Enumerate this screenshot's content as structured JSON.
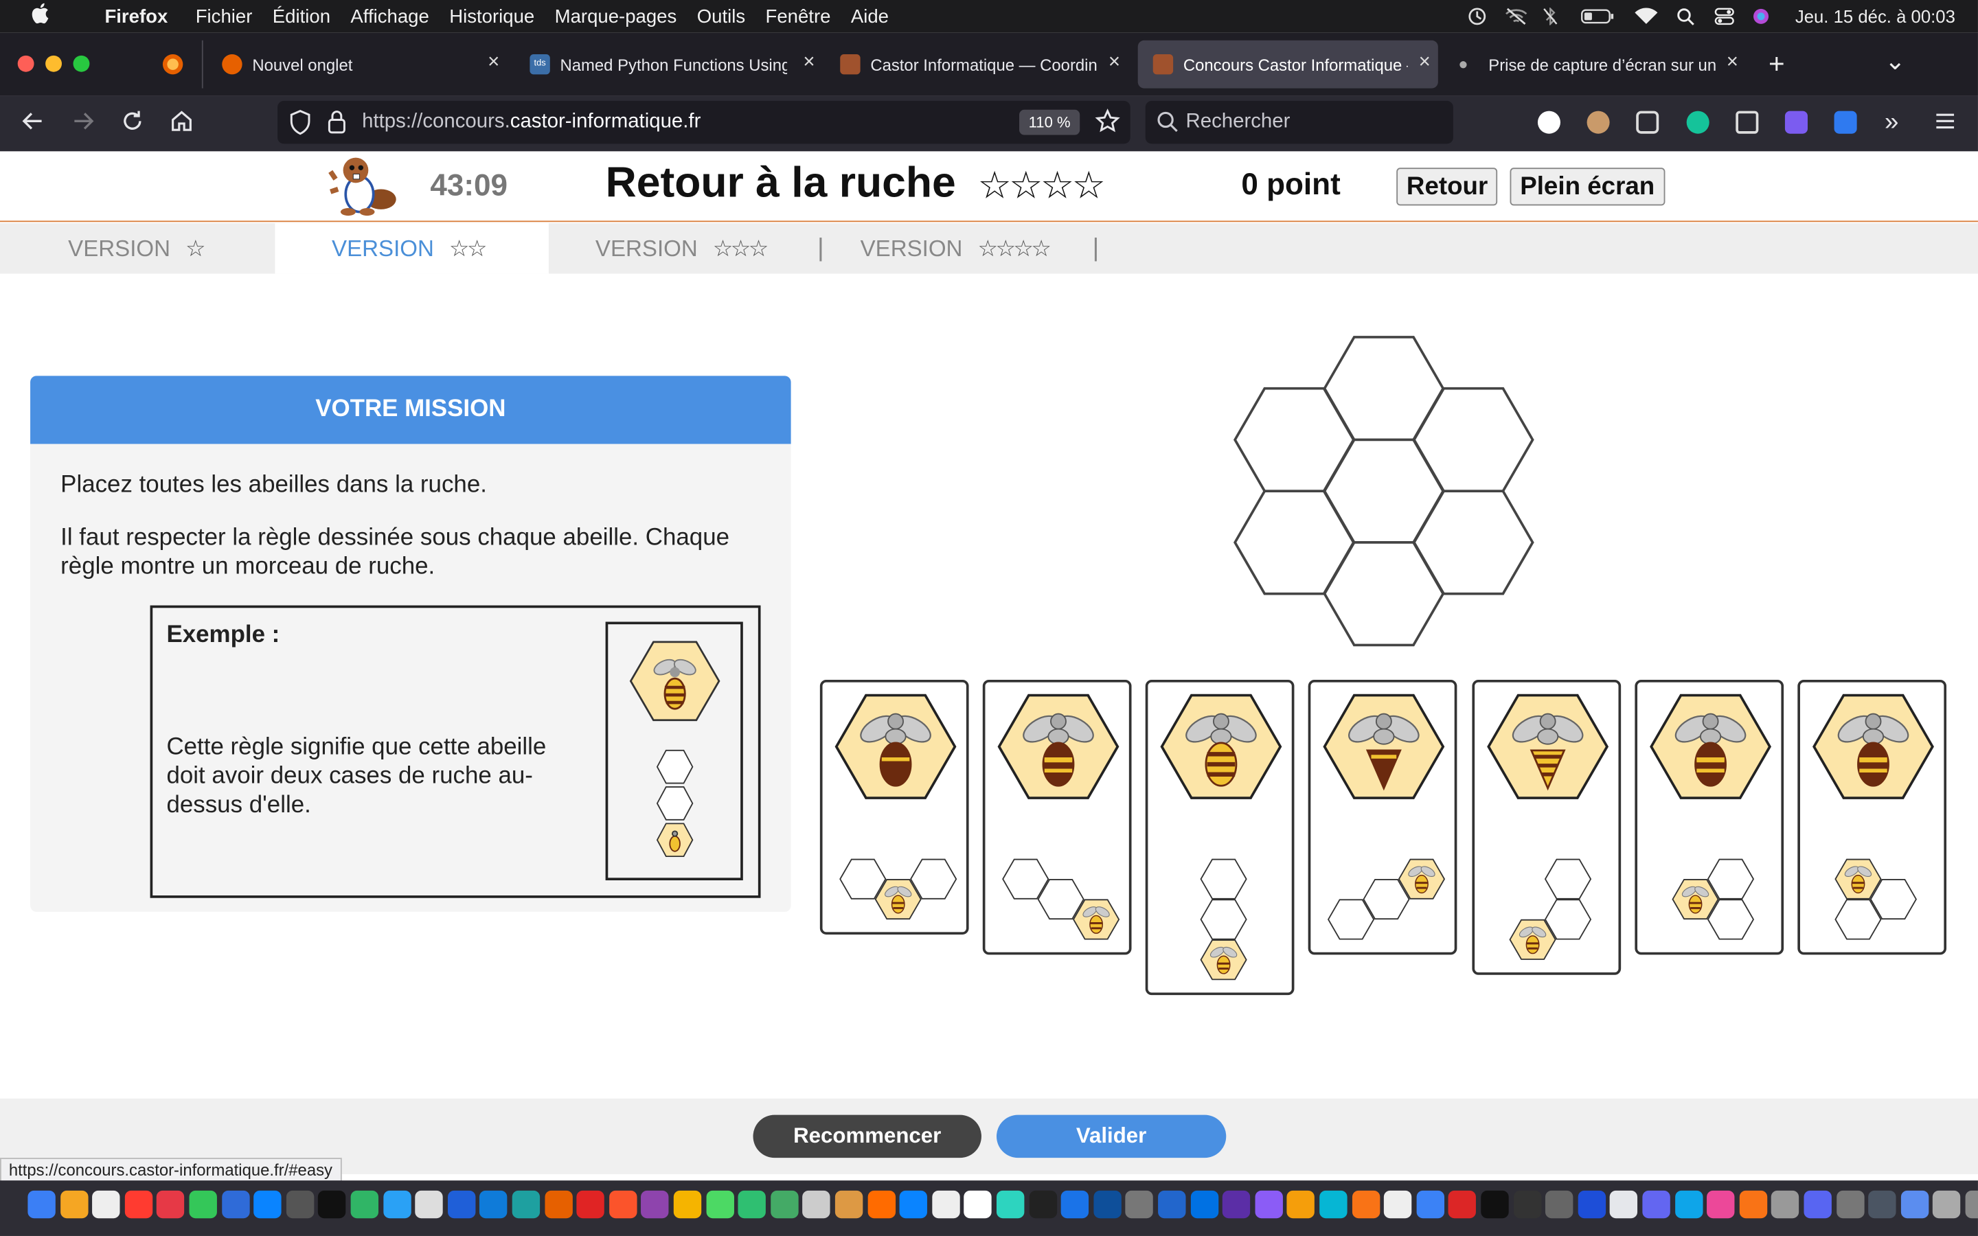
{
  "menubar": {
    "apple": "",
    "app": "Firefox",
    "items": [
      "Fichier",
      "Édition",
      "Affichage",
      "Historique",
      "Marque-pages",
      "Outils",
      "Fenêtre",
      "Aide"
    ],
    "clock": "Jeu. 15 déc. à  00:03"
  },
  "tabs": [
    {
      "title": "Nouvel onglet",
      "color": "#e66000"
    },
    {
      "title": "Named Python Functions Using",
      "color": "#3b6ea8"
    },
    {
      "title": "Castor Informatique — Coordina",
      "color": "#a0522d"
    },
    {
      "title": "Concours Castor Informatique —",
      "color": "#a0522d"
    },
    {
      "title": "Prise de capture d’écran sur un",
      "color": "#888888"
    }
  ],
  "tab_new": "+",
  "tab_list": "⌄",
  "nav": {
    "url_prefix": "https://concours.",
    "url_domain": "castor-informatique.fr",
    "zoom": "110 %",
    "search_placeholder": "Rechercher"
  },
  "header": {
    "timer": "43:09",
    "title": "Retour à la ruche",
    "stars": "☆☆☆☆",
    "points": "0 point",
    "back_label": "Retour",
    "fullscreen_label": "Plein écran"
  },
  "versions": [
    {
      "label": "VERSION",
      "stars": "☆"
    },
    {
      "label": "VERSION",
      "stars": "☆☆"
    },
    {
      "label": "VERSION",
      "stars": "☆☆☆"
    },
    {
      "label": "VERSION",
      "stars": "☆☆☆☆"
    }
  ],
  "version_sep": "|",
  "mission": {
    "heading": "VOTRE MISSION",
    "p1": "Placez toutes les abeilles dans la ruche.",
    "p2": "Il faut respecter la règle dessinée sous chaque abeille. Chaque règle montre un morceau de ruche.",
    "example_label": "Exemple :",
    "example_text": "Cette règle signifie que cette abeille doit avoir deux cases de ruche au-dessus d'elle."
  },
  "buttons": {
    "restart": "Recommencer",
    "validate": "Valider"
  },
  "status_url": "https://concours.castor-informatique.fr/#easy",
  "colors": {
    "accent": "#4a90e2",
    "hex_fill": "#fce5a8",
    "bee_brown": "#6b2a0e",
    "bee_yellow": "#f2c230",
    "restart_bg": "#444444"
  }
}
